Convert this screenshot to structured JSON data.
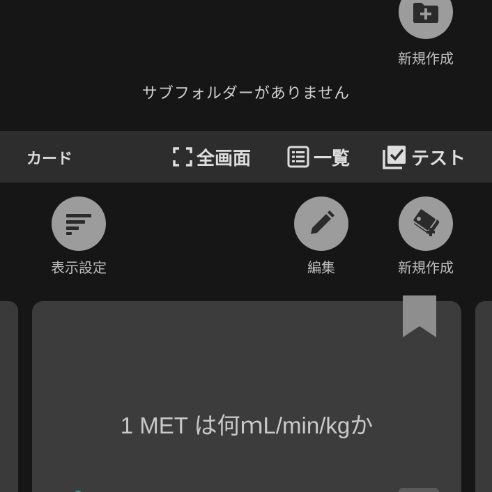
{
  "folder": {
    "new_label": "新規作成",
    "empty_message": "サブフォルダーがありません"
  },
  "card_bar": {
    "title": "カード",
    "fullscreen_label": "全画面",
    "list_label": "一覧",
    "test_label": "テスト"
  },
  "actions": {
    "display_settings_label": "表示設定",
    "edit_label": "編集",
    "new_card_label": "新規作成"
  },
  "card": {
    "question": "1 MET は何ｍL/min/kgか"
  },
  "colors": {
    "background": "#161616",
    "bar": "#2d2d2d",
    "card": "#3c3c3c",
    "icon_circle": "#9c9c9c",
    "accent_dot": "#1fa38a"
  }
}
